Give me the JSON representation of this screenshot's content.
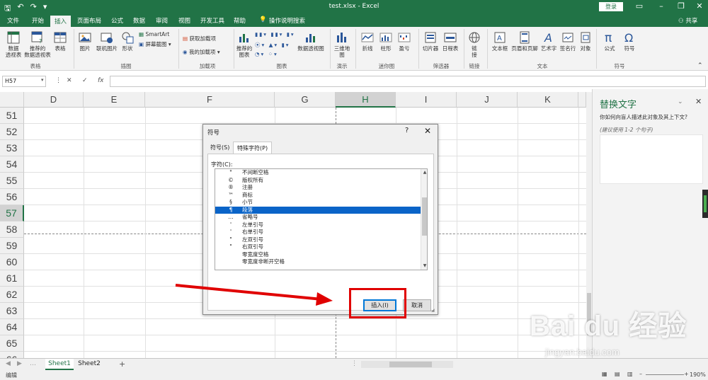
{
  "titlebar": {
    "doc_title": "test.xlsx  -  Excel",
    "login": "登录"
  },
  "tabs": [
    "文件",
    "开始",
    "插入",
    "页面布局",
    "公式",
    "数据",
    "审阅",
    "视图",
    "开发工具",
    "帮助",
    "操作说明搜索"
  ],
  "active_tab": "插入",
  "share": "共享",
  "ribbon": {
    "buttons": [
      {
        "label": "数据\n透视表"
      },
      {
        "label": "推荐的\n数据透视表"
      },
      {
        "label": "表格"
      },
      {
        "label": "图片"
      },
      {
        "label": "联机图片"
      },
      {
        "label": "形状"
      },
      {
        "label": "SmartArt"
      },
      {
        "label": "屏幕截图"
      },
      {
        "label": "获取加载项"
      },
      {
        "label": "我的加载项"
      },
      {
        "label": "推荐的\n图表"
      },
      {
        "label": "数据透视图"
      },
      {
        "label": "三维地\n图"
      },
      {
        "label": "折线"
      },
      {
        "label": "柱形"
      },
      {
        "label": "盈亏"
      },
      {
        "label": "切片器"
      },
      {
        "label": "日程表"
      },
      {
        "label": "链\n接"
      },
      {
        "label": "文本框"
      },
      {
        "label": "页眉和页脚"
      },
      {
        "label": "艺术字"
      },
      {
        "label": "签名行"
      },
      {
        "label": "对象"
      },
      {
        "label": "公式"
      },
      {
        "label": "符号"
      }
    ],
    "groups": [
      "表格",
      "插图",
      "加载项",
      "图表",
      "演示",
      "迷你图",
      "筛选器",
      "链接",
      "文本",
      "符号"
    ]
  },
  "formula_bar": {
    "name_box": "H57",
    "cancel": "✕",
    "enter": "✓",
    "fx": "fx",
    "value": ""
  },
  "grid": {
    "columns": [
      {
        "label": "D",
        "selected": false
      },
      {
        "label": "E",
        "selected": false
      },
      {
        "label": "F",
        "selected": false
      },
      {
        "label": "G",
        "selected": false
      },
      {
        "label": "H",
        "selected": true
      },
      {
        "label": "I",
        "selected": false
      },
      {
        "label": "J",
        "selected": false
      },
      {
        "label": "K",
        "selected": false
      }
    ],
    "rows": [
      {
        "label": "51",
        "selected": false
      },
      {
        "label": "52",
        "selected": false
      },
      {
        "label": "53",
        "selected": false
      },
      {
        "label": "54",
        "selected": false
      },
      {
        "label": "55",
        "selected": false
      },
      {
        "label": "56",
        "selected": false
      },
      {
        "label": "57",
        "selected": true
      },
      {
        "label": "58",
        "selected": false
      },
      {
        "label": "59",
        "selected": false
      },
      {
        "label": "60",
        "selected": false
      },
      {
        "label": "61",
        "selected": false
      },
      {
        "label": "62",
        "selected": false
      },
      {
        "label": "63",
        "selected": false
      },
      {
        "label": "64",
        "selected": false
      },
      {
        "label": "65",
        "selected": false
      },
      {
        "label": "66",
        "selected": false
      }
    ]
  },
  "alt_text_pane": {
    "title": "替换文字",
    "description": "你如何向盲人描述此对象及其上下文?",
    "hint": "(建议使用 1-2 个句子)"
  },
  "dialog": {
    "title": "符号",
    "help": "?",
    "close": "✕",
    "tabs": [
      {
        "label": "符号(S)",
        "active": false
      },
      {
        "label": "特殊字符(P)",
        "active": true
      }
    ],
    "chars_label": "字符(C):",
    "chars": [
      {
        "symbol": "°",
        "name": "不间断空格",
        "selected": false
      },
      {
        "symbol": "©",
        "name": "版权所有",
        "selected": false
      },
      {
        "symbol": "®",
        "name": "注册",
        "selected": false
      },
      {
        "symbol": "™",
        "name": "商标",
        "selected": false
      },
      {
        "symbol": "§",
        "name": "小节",
        "selected": false
      },
      {
        "symbol": "¶",
        "name": "段落",
        "selected": true
      },
      {
        "symbol": "…",
        "name": "省略号",
        "selected": false
      },
      {
        "symbol": "'",
        "name": "左单引号",
        "selected": false
      },
      {
        "symbol": "'",
        "name": "右单引号",
        "selected": false
      },
      {
        "symbol": "\"",
        "name": "左双引号",
        "selected": false
      },
      {
        "symbol": "\"",
        "name": "右双引号",
        "selected": false
      },
      {
        "symbol": "",
        "name": "零宽度空格",
        "selected": false
      },
      {
        "symbol": "",
        "name": "零宽度非断开空格",
        "selected": false
      }
    ],
    "insert_button": "插入(I)",
    "cancel_button": "取消"
  },
  "sheets": [
    {
      "label": "Sheet1",
      "active": true
    },
    {
      "label": "Sheet2",
      "active": false
    }
  ],
  "add_sheet": "+",
  "status": {
    "mode": "编辑",
    "zoom": "190%"
  },
  "watermark": {
    "brand": "Bai du 经验",
    "url": "jingyan.baidu.com"
  },
  "colors": {
    "excel_green": "#217346",
    "selection_blue": "#0a64c8",
    "annotation_red": "#e00000"
  }
}
